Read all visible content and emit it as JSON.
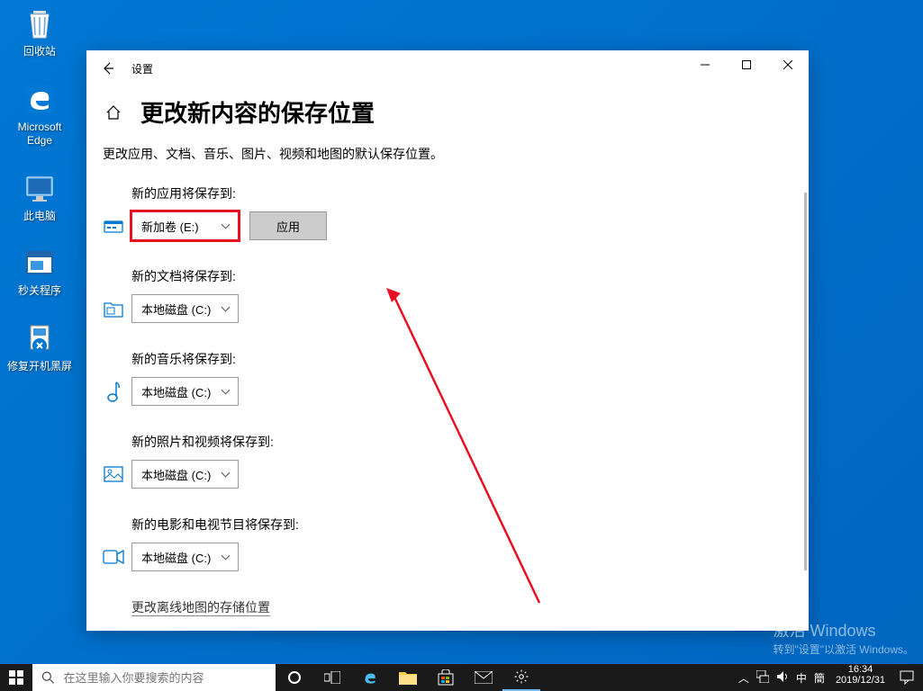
{
  "desktop": {
    "icons": [
      {
        "name": "recycle-bin",
        "label": "回收站"
      },
      {
        "name": "edge",
        "label": "Microsoft Edge"
      },
      {
        "name": "this-pc",
        "label": "此电脑"
      },
      {
        "name": "sec-close",
        "label": "秒关程序"
      },
      {
        "name": "fix-black",
        "label": "修复开机黑屏"
      }
    ]
  },
  "window": {
    "app_name": "设置",
    "page_title": "更改新内容的保存位置",
    "subtitle": "更改应用、文档、音乐、图片、视频和地图的默认保存位置。",
    "apply_btn": "应用",
    "groups": [
      {
        "label": "新的应用将保存到:",
        "value": "新加卷 (E:)",
        "highlighted": true,
        "show_apply": true,
        "icon": "apps"
      },
      {
        "label": "新的文档将保存到:",
        "value": "本地磁盘 (C:)",
        "highlighted": false,
        "show_apply": false,
        "icon": "docs"
      },
      {
        "label": "新的音乐将保存到:",
        "value": "本地磁盘 (C:)",
        "highlighted": false,
        "show_apply": false,
        "icon": "music"
      },
      {
        "label": "新的照片和视频将保存到:",
        "value": "本地磁盘 (C:)",
        "highlighted": false,
        "show_apply": false,
        "icon": "photos"
      },
      {
        "label": "新的电影和电视节目将保存到:",
        "value": "本地磁盘 (C:)",
        "highlighted": false,
        "show_apply": false,
        "icon": "video"
      }
    ],
    "footer_link": "更改离线地图的存储位置"
  },
  "watermark": {
    "line1": "激活 Windows",
    "line2": "转到\"设置\"以激活 Windows。"
  },
  "taskbar": {
    "search_placeholder": "在这里输入你要搜索的内容",
    "ime": "中",
    "ime2": "簡",
    "time": "16:34",
    "date": "2019/12/31"
  }
}
